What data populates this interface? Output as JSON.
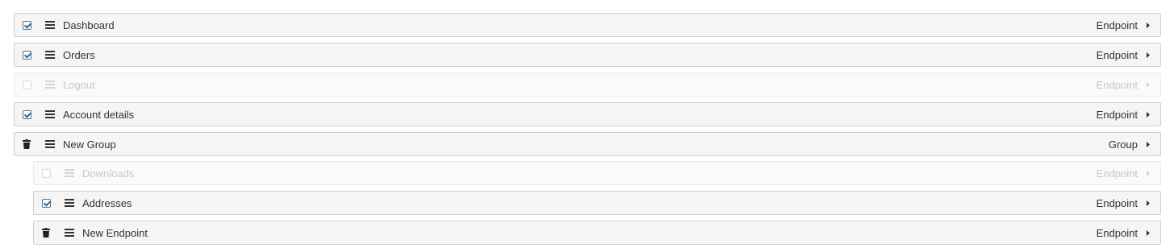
{
  "items": [
    {
      "label": "Dashboard",
      "type": "Endpoint",
      "checked": true,
      "disabled": false,
      "removable": false,
      "level": 0
    },
    {
      "label": "Orders",
      "type": "Endpoint",
      "checked": true,
      "disabled": false,
      "removable": false,
      "level": 0
    },
    {
      "label": "Logout",
      "type": "Endpoint",
      "checked": false,
      "disabled": true,
      "removable": false,
      "level": 0
    },
    {
      "label": "Account details",
      "type": "Endpoint",
      "checked": true,
      "disabled": false,
      "removable": false,
      "level": 0
    },
    {
      "label": "New Group",
      "type": "Group",
      "checked": false,
      "disabled": false,
      "removable": true,
      "level": 0
    },
    {
      "label": "Downloads",
      "type": "Endpoint",
      "checked": false,
      "disabled": true,
      "removable": false,
      "level": 1
    },
    {
      "label": "Addresses",
      "type": "Endpoint",
      "checked": true,
      "disabled": false,
      "removable": false,
      "level": 1
    },
    {
      "label": "New Endpoint",
      "type": "Endpoint",
      "checked": false,
      "disabled": false,
      "removable": true,
      "level": 1
    }
  ],
  "icons": {
    "checkbox": "checkbox",
    "remove": "trash-icon",
    "drag": "drag-handle-icon",
    "expand": "caret-right-icon"
  },
  "colors": {
    "check_accent": "#2271b1",
    "row_background": "#f5f5f5",
    "row_border": "#cfcfcf",
    "disabled_text": "#c8c8c8",
    "text": "#333333"
  }
}
